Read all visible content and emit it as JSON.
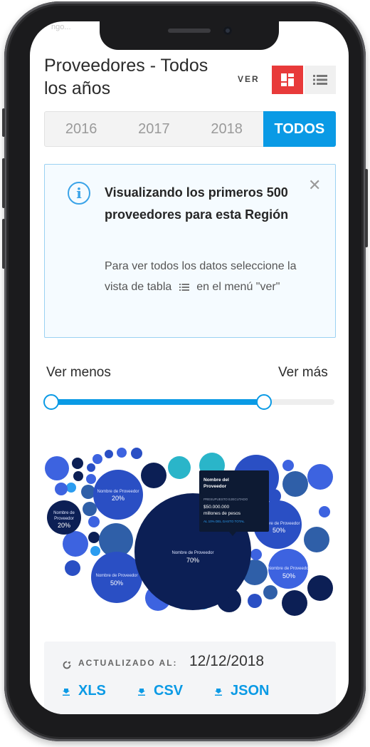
{
  "status_bar": {
    "partial_text": "ngo..."
  },
  "header": {
    "title": "Proveedores - Todos los años",
    "ver_label": "VER",
    "view_grid_icon": "grid-view-icon",
    "view_table_icon": "table-view-icon"
  },
  "years": {
    "items": [
      "2016",
      "2017",
      "2018",
      "TODOS"
    ],
    "selected": "TODOS"
  },
  "info": {
    "icon": "info-icon",
    "title": "Visualizando los primeros 500 proveedores para esta Región",
    "body_part1": "Para ver todos los datos seleccione la vista de tabla",
    "body_part2": "en el menú \"ver\"",
    "close_icon": "close-icon"
  },
  "slider": {
    "less_label": "Ver menos",
    "more_label": "Ver más",
    "min_value": 0,
    "max_value": 0.75
  },
  "bubble_chart": {
    "big_label": "Nombre de Proveedor",
    "big_pct": "70%",
    "left_top_label": "Nombre de Proveedor",
    "left_top_pct": "20%",
    "left_dark_label_line1": "Nombre de",
    "left_dark_label_line2": "Proveedor",
    "left_dark_pct": "20%",
    "left_bottom_label": "Nombre de Proveedor",
    "left_bottom_pct": "50%",
    "right_mid_label": "Nombre de Proveedor",
    "right_mid_pct": "50%",
    "right_bottom_label": "Nombre de Proveedor",
    "right_bottom_pct": "50%",
    "tooltip": {
      "title_line1": "Nombre del",
      "title_line2": "Proveedor",
      "budget_label": "PRESUPUESTO EJECUTADO",
      "amount_line1": "$50.000.000",
      "amount_line2": "millones de pesos",
      "share": "AL 10% DEL GASTO TOTAL"
    },
    "colors": {
      "navy": "#0c1f55",
      "royal": "#2a4fc4",
      "blue": "#3d63e0",
      "steel": "#2f5fa8",
      "sky": "#2b9cf0",
      "teal": "#2ab5c9"
    }
  },
  "footer": {
    "updated_label": "ACTUALIZADO AL:",
    "updated_date": "12/12/2018",
    "downloads": [
      "XLS",
      "CSV",
      "JSON"
    ],
    "download_icon": "download-icon",
    "updated_icon": "refresh-icon"
  },
  "colors": {
    "accent": "#0a9ae5",
    "view_active": "#e83a3a"
  }
}
